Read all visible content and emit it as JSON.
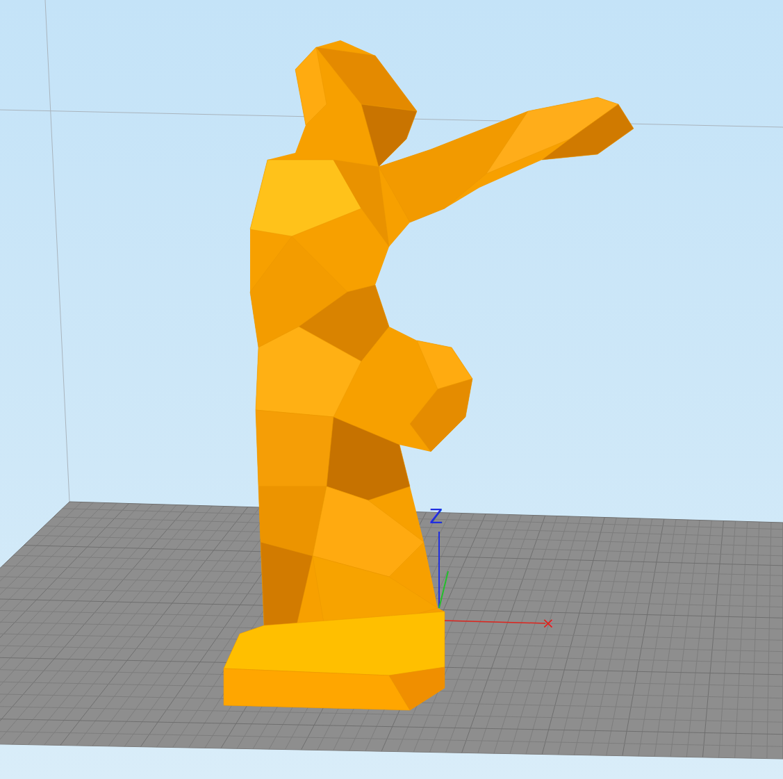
{
  "viewport": {
    "axes": [
      {
        "label": "Z",
        "color": "#1f2ee0"
      },
      {
        "label": "×",
        "color": "#e0251e"
      }
    ]
  }
}
